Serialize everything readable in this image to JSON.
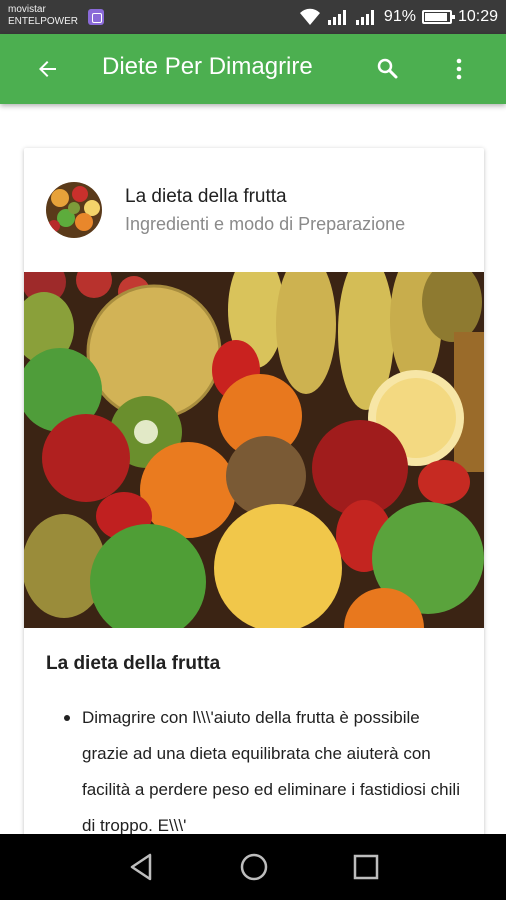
{
  "status_bar": {
    "carrier_line1": "movistar",
    "carrier_line2": "ENTELPOWER",
    "battery_percent": "91%",
    "time": "10:29"
  },
  "app_bar": {
    "title": "Diete Per Dimagrire",
    "back_icon": "arrow-back-icon",
    "search_icon": "search-icon",
    "more_icon": "more-vert-icon",
    "color": "#4caf50"
  },
  "card": {
    "title": "La dieta della frutta",
    "subtitle": "Ingredienti e modo di Preparazione",
    "section_title": "La dieta della frutta",
    "bullets": [
      "Dimagrire con l\\\\\\'aiuto della frutta è possibile grazie ad una dieta equilibrata che aiuterà con facilità a perdere peso ed eliminare i fastidiosi chili di troppo. E\\\\\\'"
    ]
  },
  "nav_bar": {
    "back_icon": "nav-back-icon",
    "home_icon": "nav-home-icon",
    "recents_icon": "nav-recents-icon"
  }
}
